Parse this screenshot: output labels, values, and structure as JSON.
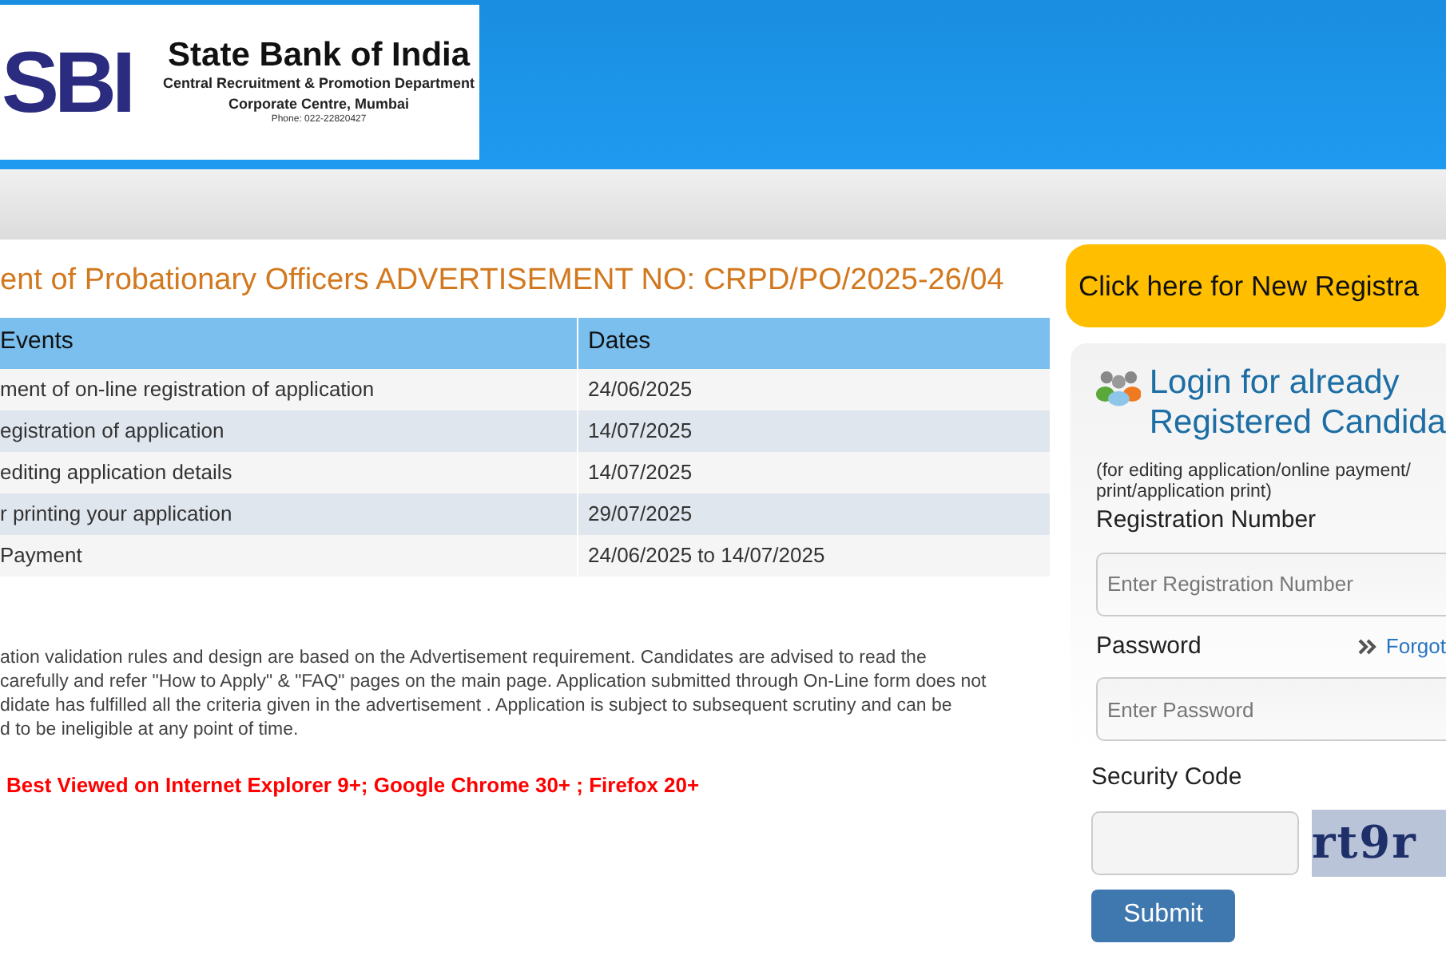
{
  "header": {
    "logo_text": "SBI",
    "bank_name": "State Bank of India",
    "department": "Central Recruitment & Promotion Department",
    "office": "Corporate Centre, Mumbai",
    "phone": "Phone: 022-22820427"
  },
  "title": "ent of Probationary Officers ADVERTISEMENT NO: CRPD/PO/2025-26/04",
  "table": {
    "columns": [
      "Events",
      "Dates"
    ],
    "rows": [
      [
        "ment of on-line registration of application",
        "24/06/2025"
      ],
      [
        "egistration of application",
        "14/07/2025"
      ],
      [
        "editing application details",
        "14/07/2025"
      ],
      [
        "r printing your application",
        "29/07/2025"
      ],
      [
        "Payment",
        "24/06/2025 to 14/07/2025"
      ]
    ]
  },
  "note_lines": [
    "ation validation rules and design are based on the Advertisement requirement. Candidates are advised to read the",
    "carefully and refer \"How to Apply\" & \"FAQ\" pages on the main page. Application submitted through On-Line form does not",
    "didate has fulfilled all the criteria given in the advertisement . Application is subject to subsequent scrutiny and can be",
    "d to be ineligible at any point of time."
  ],
  "browser_note": "Best Viewed on Internet Explorer 9+; Google Chrome 30+ ; Firefox 20+",
  "new_registration": "Click here for New Registra",
  "login": {
    "title_lines": [
      "Login for already",
      "Registered Candida"
    ],
    "hint_lines": [
      "(for editing application/online payment/",
      "print/application print)"
    ],
    "registration_label": "Registration Number",
    "registration_placeholder": "Enter Registration Number",
    "password_label": "Password",
    "forgot_link": "Forgot",
    "password_placeholder": "Enter Password"
  },
  "security_label": "Security Code",
  "captcha_text": "rt9r",
  "submit": "Submit"
}
